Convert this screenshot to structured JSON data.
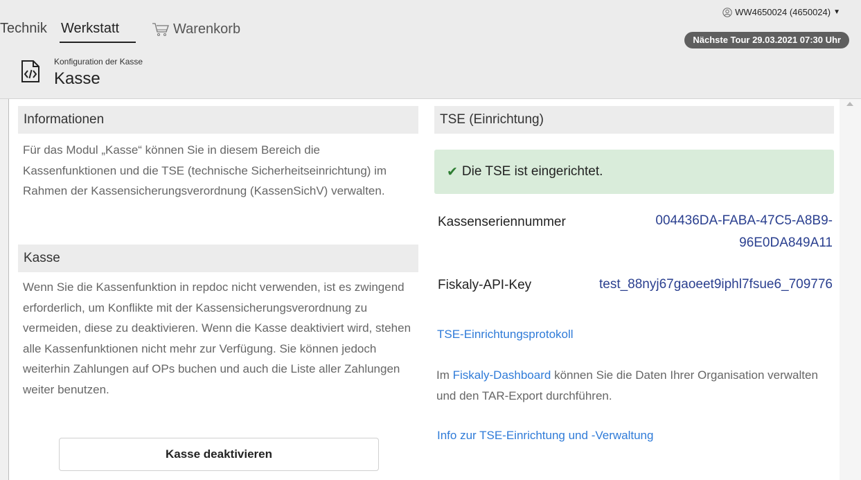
{
  "nav": {
    "tabs": [
      "Technik",
      "Werkstatt",
      "Warenkorb"
    ],
    "active": "Werkstatt"
  },
  "user": {
    "label": "WW4650024 (4650024)"
  },
  "tour": {
    "label": "Nächste Tour 29.03.2021 07:30 Uhr"
  },
  "page": {
    "subtitle": "Konfiguration der Kasse",
    "title": "Kasse"
  },
  "left": {
    "info_heading": "Informationen",
    "info_text": "Für das Modul „Kasse“ können Sie in diesem Bereich die Kassenfunktionen und die TSE (technische Sicherheitseinrichtung) im Rahmen der Kassensicherungsverordnung (KassenSichV) verwalten.",
    "kasse_heading": "Kasse",
    "kasse_text": "Wenn Sie die Kassenfunktion in repdoc nicht verwenden, ist es zwingend erforderlich, um Konflikte mit der Kassensicherungsverordnung zu vermeiden, diese zu deaktivieren. Wenn die Kasse deaktiviert wird, stehen alle Kassenfunktionen nicht mehr zur Verfügung. Sie können jedoch weiterhin Zahlungen auf OPs buchen und auch die Liste aller Zahlungen weiter benutzen.",
    "deactivate_button": "Kasse deaktivieren"
  },
  "right": {
    "heading": "TSE (Einrichtung)",
    "alert": "Die TSE ist eingerichtet.",
    "serial_label": "Kassenseriennummer",
    "serial_value_line1": "004436DA-FABA-47C5-A8B9-",
    "serial_value_line2": "96E0DA849A11",
    "apikey_label": "Fiskaly-API-Key",
    "apikey_value": "test_88nyj67gaoeet9iphl7fsue6_709776",
    "protocol_link": "TSE-Einrichtungsprotokoll",
    "dashboard_pre": "Im ",
    "dashboard_link": "Fiskaly-Dashboard",
    "dashboard_post": " können Sie die Daten Ihrer Organisation verwalten und den TAR-Export durchführen.",
    "info_link": "Info zur TSE-Einrichtung und -Verwaltung"
  },
  "colors": {
    "accent_link": "#2f7bd8",
    "success_bg": "#d9ecda",
    "badge_bg": "#5f5f5f"
  }
}
